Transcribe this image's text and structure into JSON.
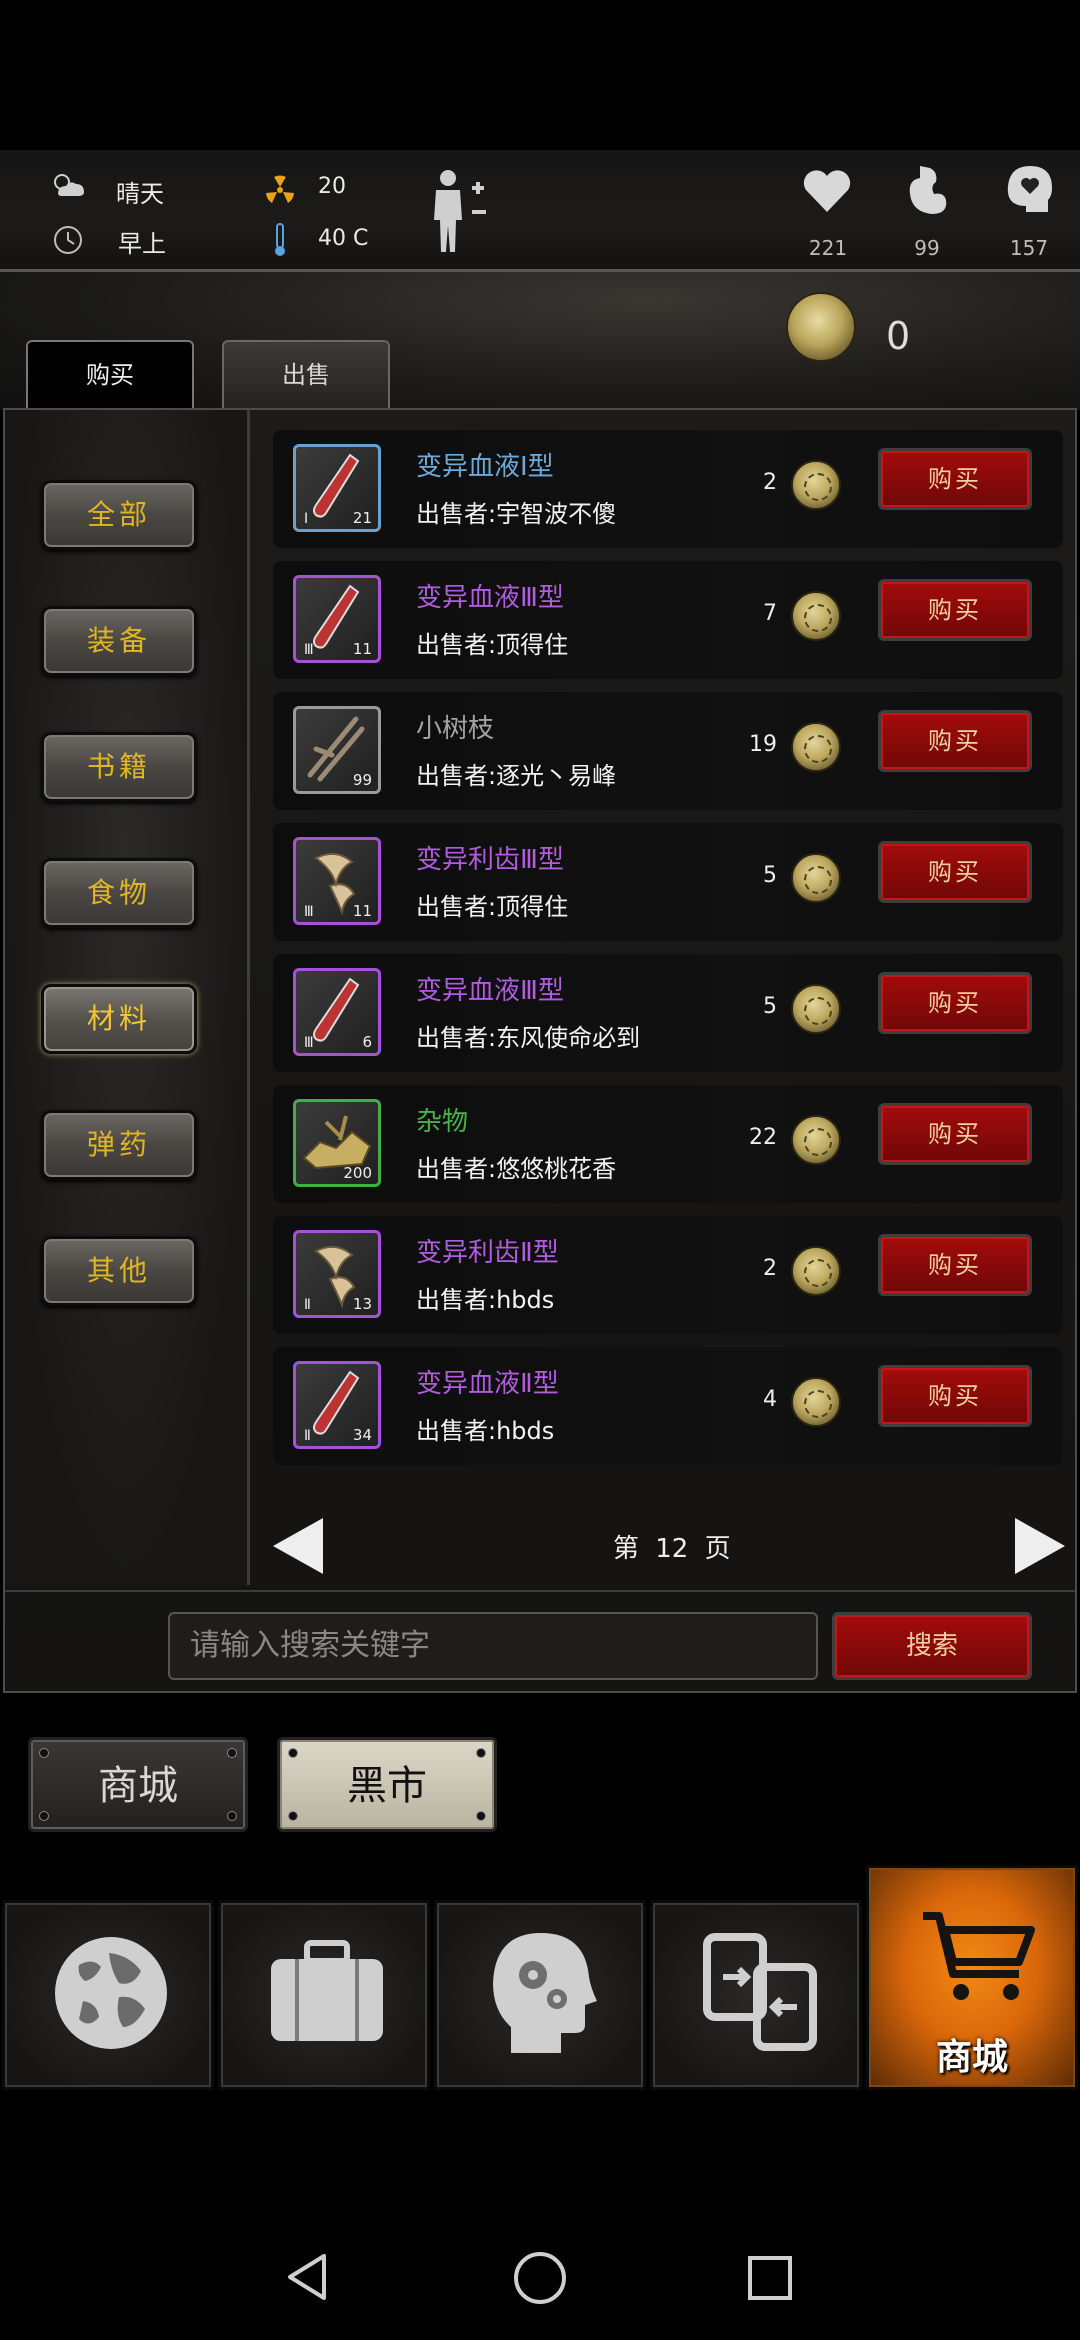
{
  "status": {
    "weather": "晴天",
    "time_of_day": "早上",
    "radiation": "20",
    "temperature": "40 C",
    "health": "221",
    "hunger": "99",
    "mood": "157"
  },
  "shop": {
    "tabs": [
      "购买",
      "出售"
    ],
    "coins": "0"
  },
  "categories": [
    "全部",
    "装备",
    "书籍",
    "食物",
    "材料",
    "弹药",
    "其他"
  ],
  "selected_category": "材料",
  "items": [
    {
      "name": "变异血液Ⅰ型",
      "seller": "出售者:宇智波不傻",
      "price": "2",
      "tier": "Ⅰ",
      "qty": "21",
      "rarity": "blue",
      "icon": "blood-vial-icon"
    },
    {
      "name": "变异血液Ⅲ型",
      "seller": "出售者:顶得住",
      "price": "7",
      "tier": "Ⅲ",
      "qty": "11",
      "rarity": "purple",
      "icon": "blood-vial-icon"
    },
    {
      "name": "小树枝",
      "seller": "出售者:逐光丶易峰",
      "price": "19",
      "tier": "",
      "qty": "99",
      "rarity": "gray",
      "icon": "twig-icon"
    },
    {
      "name": "变异利齿Ⅲ型",
      "seller": "出售者:顶得住",
      "price": "5",
      "tier": "Ⅲ",
      "qty": "11",
      "rarity": "purple",
      "icon": "fang-icon"
    },
    {
      "name": "变异血液Ⅲ型",
      "seller": "出售者:东风使命必到",
      "price": "5",
      "tier": "Ⅲ",
      "qty": "6",
      "rarity": "purple",
      "icon": "blood-vial-icon"
    },
    {
      "name": "杂物",
      "seller": "出售者:悠悠桃花香",
      "price": "22",
      "tier": "",
      "qty": "200",
      "rarity": "green",
      "icon": "junk-icon"
    },
    {
      "name": "变异利齿Ⅱ型",
      "seller": "出售者:hbds",
      "price": "2",
      "tier": "Ⅱ",
      "qty": "13",
      "rarity": "purple",
      "icon": "fang-icon"
    },
    {
      "name": "变异血液Ⅱ型",
      "seller": "出售者:hbds",
      "price": "4",
      "tier": "Ⅱ",
      "qty": "34",
      "rarity": "purple",
      "icon": "blood-vial-icon"
    }
  ],
  "buy_label": "购买",
  "pager": {
    "text": "第 12 页"
  },
  "search": {
    "placeholder": "请输入搜索关键字",
    "button": "搜索"
  },
  "market": {
    "shop": "商城",
    "black_market": "黑市"
  },
  "nav": {
    "active_label": "商城"
  },
  "colors": {
    "accent_red": "#8a0a0a",
    "active_tab_orange": "#e07a12",
    "category_text": "#e0b623"
  }
}
